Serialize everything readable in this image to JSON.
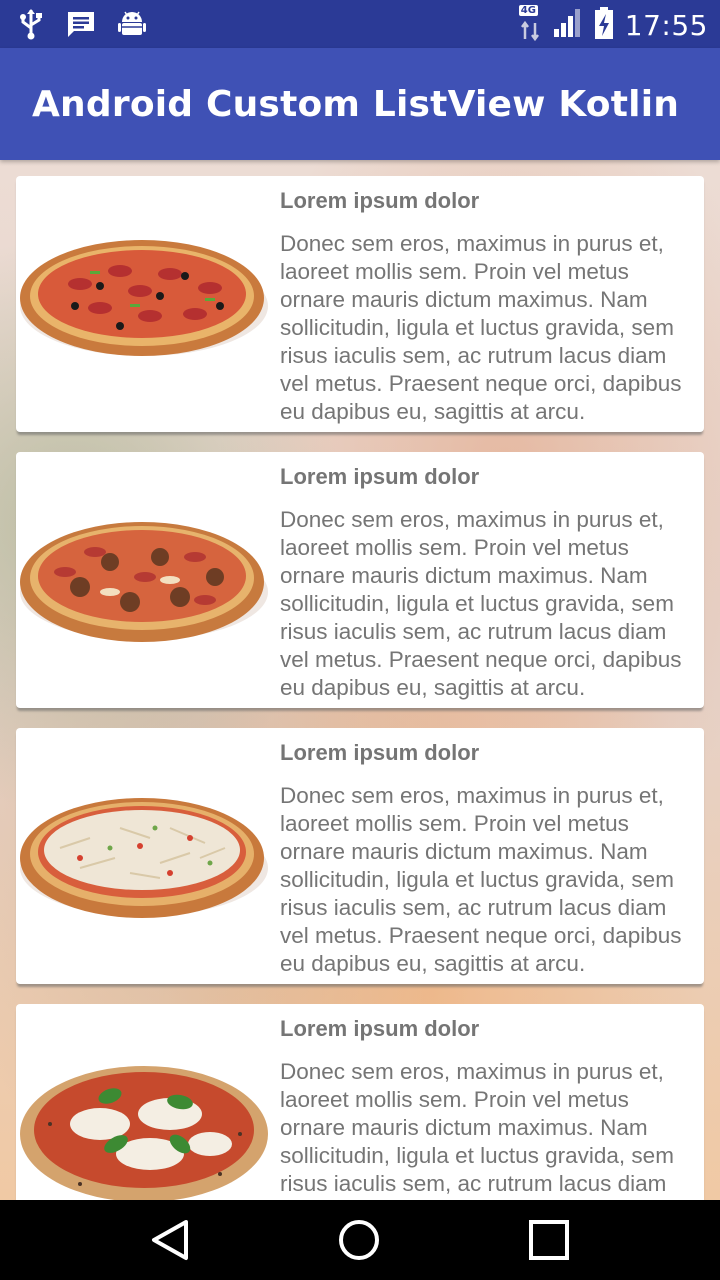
{
  "status_bar": {
    "time": "17:55",
    "network": "4G",
    "left_icons": [
      "usb-icon",
      "message-icon",
      "android-icon"
    ],
    "right_icons": [
      "network-icon",
      "signal-icon",
      "battery-icon"
    ]
  },
  "app_bar": {
    "title": "Android Custom ListView Kotlin",
    "color": "#3f51b5"
  },
  "list": {
    "items": [
      {
        "title": "Lorem ipsum dolor",
        "description": "Donec sem eros, maximus in purus et, laoreet mollis sem. Proin vel metus ornare mauris dictum maximus. Nam sollicitudin, ligula et luctus gravida, sem risus iaculis sem, ac rutrum lacus diam vel metus. Praesent neque orci, dapibus eu dapibus eu, sagittis at arcu.",
        "image": "pepperoni-pizza-image"
      },
      {
        "title": "Lorem ipsum dolor",
        "description": "Donec sem eros, maximus in purus et, laoreet mollis sem. Proin vel metus ornare mauris dictum maximus. Nam sollicitudin, ligula et luctus gravida, sem risus iaculis sem, ac rutrum lacus diam vel metus. Praesent neque orci, dapibus eu dapibus eu, sagittis at arcu.",
        "image": "meat-pizza-image"
      },
      {
        "title": "Lorem ipsum dolor",
        "description": "Donec sem eros, maximus in purus et, laoreet mollis sem. Proin vel metus ornare mauris dictum maximus. Nam sollicitudin, ligula et luctus gravida, sem risus iaculis sem, ac rutrum lacus diam vel metus. Praesent neque orci, dapibus eu dapibus eu, sagittis at arcu.",
        "image": "cheese-pizza-image"
      },
      {
        "title": "Lorem ipsum dolor",
        "description": "Donec sem eros, maximus in purus et, laoreet mollis sem. Proin vel metus ornare mauris dictum maximus. Nam sollicitudin, ligula et luctus gravida, sem risus iaculis sem, ac rutrum lacus diam vel metus. Praesent neque orci, dapibus eu dapibus eu, sagittis at arcu.",
        "image": "margherita-pizza-image"
      }
    ]
  },
  "nav_bar": {
    "buttons": [
      "back-icon",
      "home-icon",
      "recents-icon"
    ]
  }
}
